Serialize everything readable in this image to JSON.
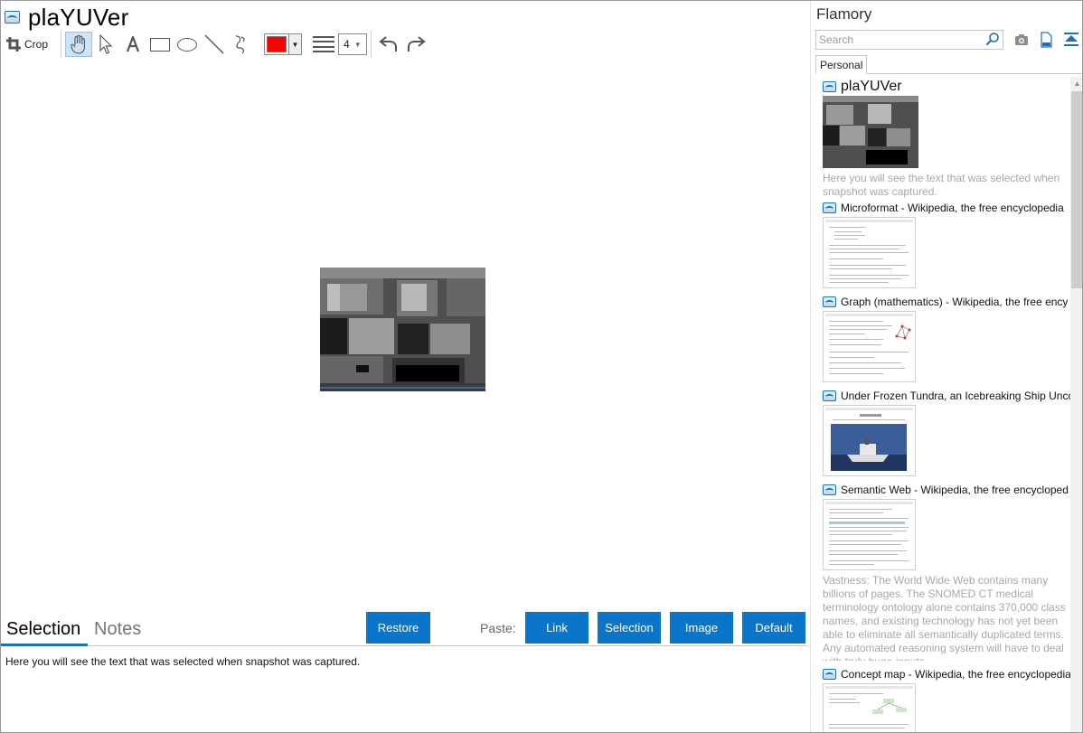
{
  "app": {
    "title": "plaYUVer"
  },
  "toolbar": {
    "crop_label": "Crop",
    "line_width": "4",
    "stroke_color": "#ff0000"
  },
  "bottom": {
    "tab_selection": "Selection",
    "tab_notes": "Notes",
    "restore": "Restore",
    "paste_label": "Paste:",
    "paste_link": "Link",
    "paste_selection": "Selection",
    "paste_image": "Image",
    "paste_default": "Default",
    "selection_text": "Here you will see the text that was selected when snapshot was captured."
  },
  "sidebar": {
    "title": "Flamory",
    "search_placeholder": "Search",
    "tab_personal": "Personal",
    "entries": [
      {
        "title": "plaYUVer",
        "desc": "Here you will see the text that was selected when snapshot was captured."
      },
      {
        "title": "Microformat - Wikipedia, the free encyclopedia"
      },
      {
        "title": "Graph (mathematics) - Wikipedia, the free ency"
      },
      {
        "title": "Under Frozen Tundra, an Icebreaking Ship Unco"
      },
      {
        "title": "Semantic Web - Wikipedia, the free encycloped",
        "desc": "Vastness: The World Wide Web contains many billions of pages. The SNOMED CT medical terminology ontology alone contains 370,000 class names, and existing technology has not yet been able to eliminate all semantically duplicated terms. Any automated reasoning system will have to deal with truly huge inputs."
      },
      {
        "title": "Concept map - Wikipedia, the free encyclopedia"
      }
    ]
  },
  "colors": {
    "accent": "#0b76c9",
    "stroke": "#ff0000"
  }
}
